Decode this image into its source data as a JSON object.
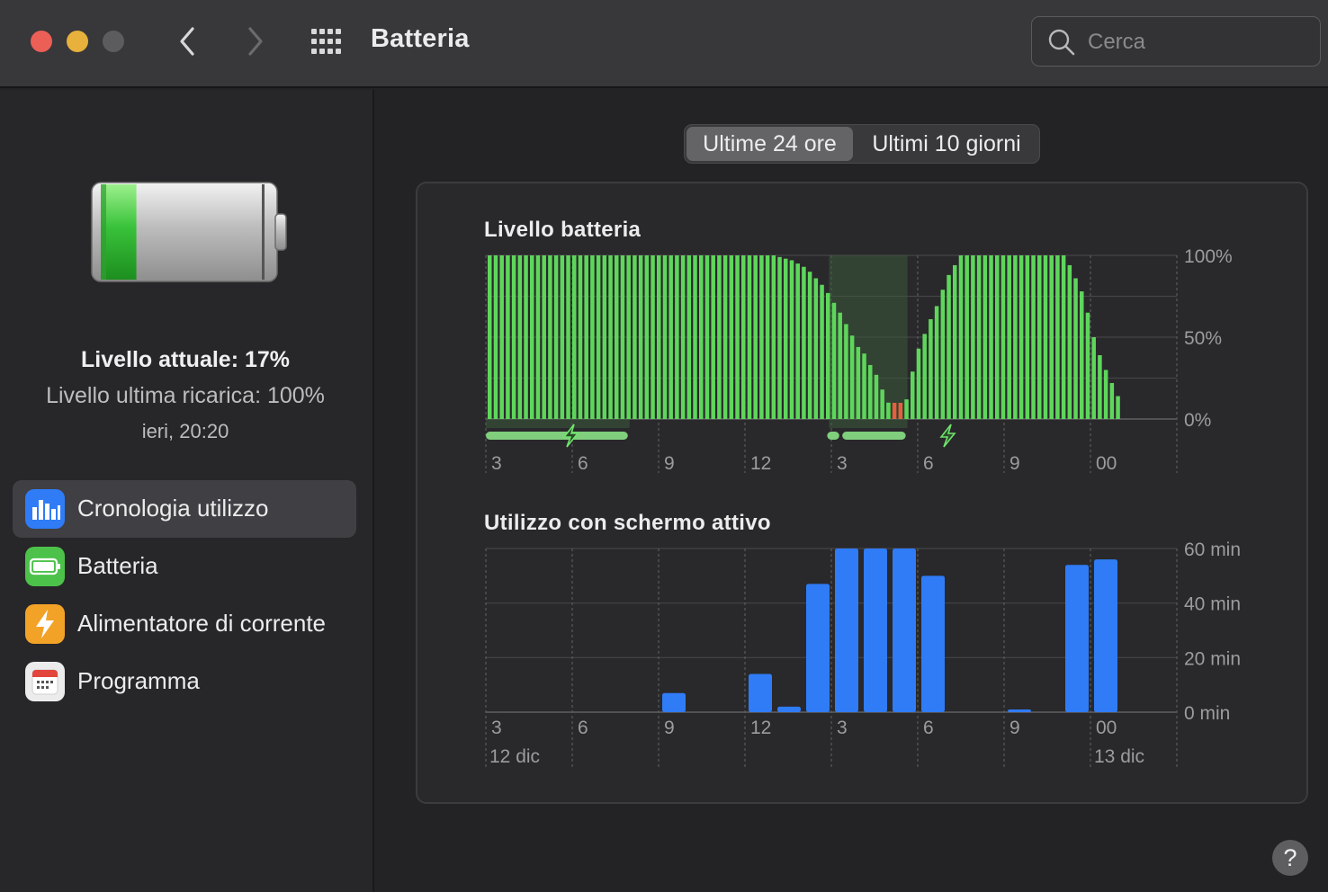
{
  "window": {
    "title": "Batteria",
    "search_placeholder": "Cerca"
  },
  "sidebar": {
    "current_level": "Livello attuale: 17%",
    "last_charge": "Livello ultima ricarica: 100%",
    "last_charge_time": "ieri, 20:20",
    "battery_fill_fraction": 0.17,
    "items": [
      {
        "label": "Cronologia utilizzo",
        "icon": "bar-chart-icon",
        "color": "#2f7cf6",
        "active": true
      },
      {
        "label": "Batteria",
        "icon": "battery-icon",
        "color": "#4cc24a",
        "active": false
      },
      {
        "label": "Alimentatore di corrente",
        "icon": "lightning-icon",
        "color": "#f2a227",
        "active": false
      },
      {
        "label": "Programma",
        "icon": "calendar-icon",
        "color": "#ececec",
        "active": false
      }
    ]
  },
  "tabs": {
    "selected": "Ultime 24 ore",
    "other": "Ultimi 10 giorni"
  },
  "help_label": "?",
  "chart_data": [
    {
      "type": "bar",
      "title": "Livello batteria",
      "y_ticks": [
        "100%",
        "50%",
        "0%"
      ],
      "ylim": [
        0,
        100
      ],
      "x_ticks": [
        "3",
        "6",
        "9",
        "12",
        "3",
        "6",
        "9",
        "00"
      ],
      "color": "#5ed65b",
      "low_color": "#e5613d",
      "charging_color": "#7fcf7c",
      "values": [
        100,
        100,
        100,
        100,
        100,
        100,
        100,
        100,
        100,
        100,
        100,
        100,
        100,
        100,
        100,
        100,
        100,
        100,
        100,
        100,
        100,
        100,
        100,
        100,
        100,
        100,
        100,
        100,
        100,
        100,
        100,
        100,
        100,
        100,
        100,
        100,
        100,
        100,
        100,
        100,
        100,
        100,
        100,
        100,
        100,
        100,
        100,
        100,
        99,
        98,
        97,
        95,
        93,
        90,
        86,
        82,
        77,
        71,
        65,
        58,
        51,
        44,
        40,
        33,
        27,
        18,
        10,
        0,
        7,
        12,
        29,
        43,
        52,
        61,
        69,
        79,
        88,
        94,
        100,
        100,
        100,
        100,
        100,
        100,
        100,
        100,
        100,
        100,
        100,
        100,
        100,
        100,
        100,
        100,
        100,
        100,
        94,
        86,
        78,
        65,
        50,
        39,
        30,
        22,
        14
      ],
      "low_indices": [
        67,
        68
      ],
      "charging_periods": [
        [
          0,
          23.5
        ],
        [
          56.5,
          58.5
        ],
        [
          59,
          69.5
        ]
      ],
      "charging_shade": [
        56.5,
        69.5
      ]
    },
    {
      "type": "bar",
      "title": "Utilizzo con schermo attivo",
      "y_ticks": [
        "60 min",
        "40 min",
        "20 min",
        "0 min"
      ],
      "ylim": [
        0,
        60
      ],
      "x_ticks": [
        "3",
        "6",
        "9",
        "12",
        "3",
        "6",
        "9",
        "00"
      ],
      "date_labels": [
        "12 dic",
        "13 dic"
      ],
      "color": "#2f7cf6",
      "values": [
        0,
        0,
        0,
        0,
        0,
        0,
        7,
        0,
        0,
        14,
        2,
        47,
        60,
        60,
        60,
        50,
        0,
        0,
        1,
        0,
        54,
        56,
        0,
        0
      ]
    }
  ]
}
